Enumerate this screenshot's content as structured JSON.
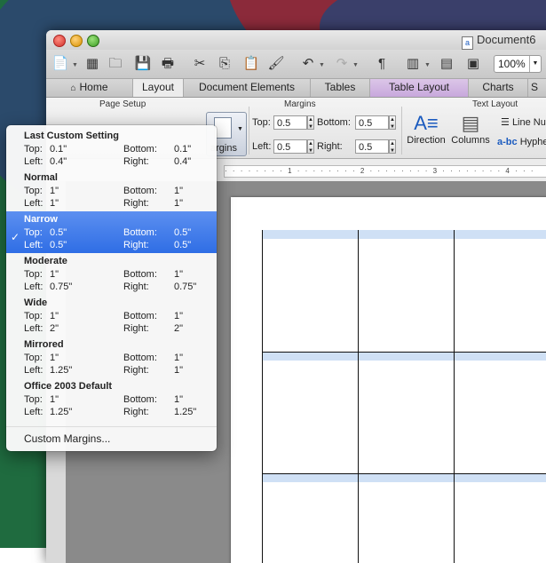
{
  "window": {
    "title": "Document6",
    "zoom": "100%"
  },
  "tabs": [
    {
      "label": "Home"
    },
    {
      "label": "Layout"
    },
    {
      "label": "Document Elements"
    },
    {
      "label": "Tables"
    },
    {
      "label": "Table Layout"
    },
    {
      "label": "Charts"
    },
    {
      "label": "S"
    }
  ],
  "ribbon": {
    "page_setup": "Page Setup",
    "margins_group": "Margins",
    "text_layout": "Text Layout",
    "margins_button": "argins",
    "top_label": "Top:",
    "top_value": "0.5",
    "bottom_label": "Bottom:",
    "bottom_value": "0.5",
    "left_label": "Left:",
    "left_value": "0.5",
    "right_label": "Right:",
    "right_value": "0.5",
    "direction": "Direction",
    "columns": "Columns",
    "line_numbers": "Line Nu",
    "hyphenation": "Hypher"
  },
  "ruler": {
    "text": "· · · · · · · · 1 · · · · · · · · 2 · · · · · · · · 3 · · · · · · · · 4 · · ·"
  },
  "menu": {
    "presets": [
      {
        "name": "Last Custom Setting",
        "top_label": "Top:",
        "top": "0.1\"",
        "bottom_label": "Bottom:",
        "bottom": "0.1\"",
        "left_label": "Left:",
        "left": "0.4\"",
        "right_label": "Right:",
        "right": "0.4\""
      },
      {
        "name": "Normal",
        "top_label": "Top:",
        "top": "1\"",
        "bottom_label": "Bottom:",
        "bottom": "1\"",
        "left_label": "Left:",
        "left": "1\"",
        "right_label": "Right:",
        "right": "1\""
      },
      {
        "name": "Narrow",
        "top_label": "Top:",
        "top": "0.5\"",
        "bottom_label": "Bottom:",
        "bottom": "0.5\"",
        "left_label": "Left:",
        "left": "0.5\"",
        "right_label": "Right:",
        "right": "0.5\"",
        "check": "✓"
      },
      {
        "name": "Moderate",
        "top_label": "Top:",
        "top": "1\"",
        "bottom_label": "Bottom:",
        "bottom": "1\"",
        "left_label": "Left:",
        "left": "0.75\"",
        "right_label": "Right:",
        "right": "0.75\""
      },
      {
        "name": "Wide",
        "top_label": "Top:",
        "top": "1\"",
        "bottom_label": "Bottom:",
        "bottom": "1\"",
        "left_label": "Left:",
        "left": "2\"",
        "right_label": "Right:",
        "right": "2\""
      },
      {
        "name": "Mirrored",
        "top_label": "Top:",
        "top": "1\"",
        "bottom_label": "Bottom:",
        "bottom": "1\"",
        "left_label": "Left:",
        "left": "1.25\"",
        "right_label": "Right:",
        "right": "1\""
      },
      {
        "name": "Office 2003 Default",
        "top_label": "Top:",
        "top": "1\"",
        "bottom_label": "Bottom:",
        "bottom": "1\"",
        "left_label": "Left:",
        "left": "1.25\"",
        "right_label": "Right:",
        "right": "1.25\""
      }
    ],
    "custom_margins": "Custom Margins..."
  },
  "colors": {
    "selection": "#2f6ee5",
    "table_layout_tab": "#c8a8dc",
    "table_header": "#cfe0f5"
  }
}
